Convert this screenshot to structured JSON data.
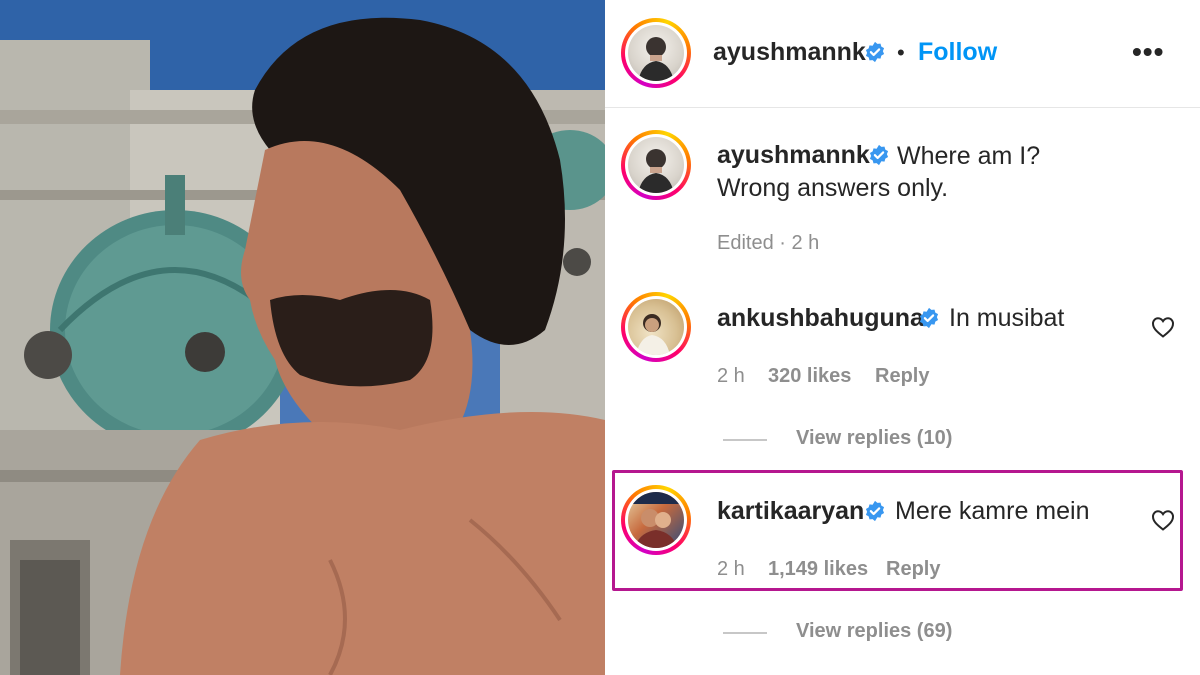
{
  "post": {
    "username": "ayushmannk",
    "follow_label": "Follow",
    "separator": "•",
    "more_label": "•••"
  },
  "caption": {
    "username": "ayushmannk",
    "text_line1": "Where am I?",
    "text_line2": "Wrong answers only.",
    "meta": "Edited · 2 h"
  },
  "comments": [
    {
      "username": "ankushbahuguna",
      "text": "In musibat",
      "time": "2 h",
      "likes": "320 likes",
      "reply_label": "Reply",
      "view_replies": "View replies (10)"
    },
    {
      "username": "kartikaaryan",
      "text": "Mere kamre mein",
      "time": "2 h",
      "likes": "1,149 likes",
      "reply_label": "Reply",
      "view_replies": "View replies (69)"
    }
  ],
  "colors": {
    "follow": "#0095f6",
    "verified": "#3897f0",
    "highlight": "#b5178f",
    "muted": "#8e8e8e"
  },
  "icons": [
    "verified-badge-icon",
    "heart-icon",
    "more-options-icon"
  ]
}
